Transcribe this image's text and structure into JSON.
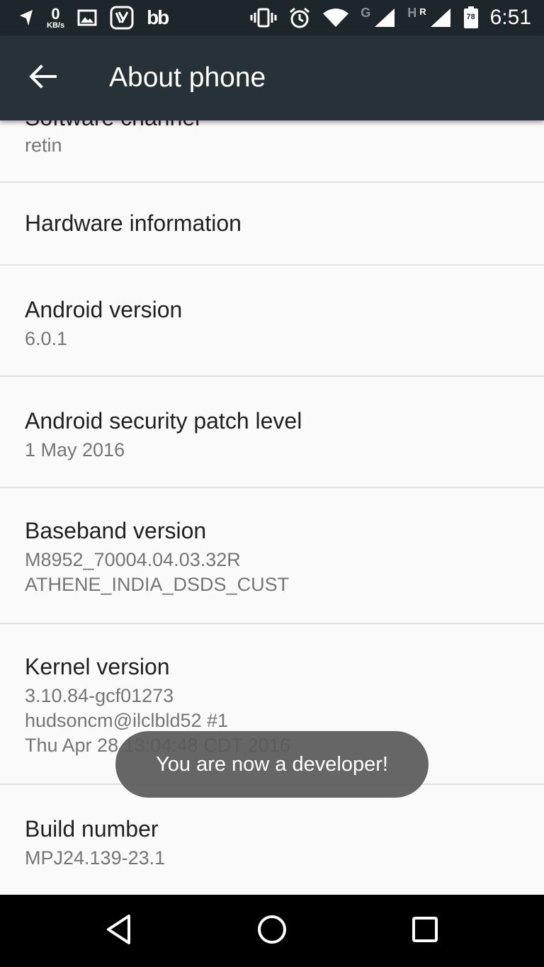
{
  "status_bar": {
    "speed_value": "0",
    "speed_unit": "KB/s",
    "bb_label": "bb",
    "network_g": "G",
    "network_h": "H",
    "network_r": "R",
    "battery_level": "78",
    "time": "6:51"
  },
  "app_bar": {
    "title": "About phone"
  },
  "list": {
    "partial_item": {
      "title": "Software channel",
      "summary": "retin"
    },
    "hardware_info": {
      "title": "Hardware information"
    },
    "android_version": {
      "title": "Android version",
      "summary": "6.0.1"
    },
    "security_patch": {
      "title": "Android security patch level",
      "summary": "1 May 2016"
    },
    "baseband": {
      "title": "Baseband version",
      "summary_line1": "M8952_70004.04.03.32R",
      "summary_line2": "ATHENE_INDIA_DSDS_CUST"
    },
    "kernel": {
      "title": "Kernel version",
      "summary_line1": "3.10.84-gcf01273",
      "summary_line2": "hudsoncm@ilclbld52 #1",
      "summary_line3": "Thu Apr 28 13:04:48 CDT 2016"
    },
    "build_number": {
      "title": "Build number",
      "summary": "MPJ24.139-23.1"
    }
  },
  "toast": {
    "message": "You are now a developer!"
  },
  "icons": {
    "status": [
      "navigation-icon",
      "image-icon",
      "app-icon",
      "vibrate-icon",
      "alarm-icon",
      "wifi-icon",
      "signal-icon",
      "battery-icon"
    ],
    "nav": [
      "back-icon",
      "home-icon",
      "recents-icon"
    ]
  }
}
